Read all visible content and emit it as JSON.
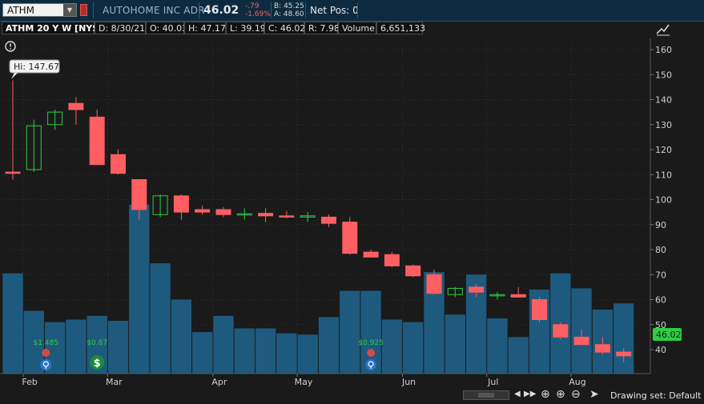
{
  "toolbar": {
    "symbol": "ATHM",
    "company_name": "AUTOHOME INC ADR",
    "last_price": "46.02",
    "net_change": "-.79",
    "pct_change": "-1.69%",
    "bid": "B: 45.25",
    "ask": "A: 48.60",
    "net_pos": "Net Pos: 0"
  },
  "info_bar": {
    "title": "ATHM 20 Y W [NYSE]",
    "date": "D: 8/30/21",
    "open": "O: 40.03",
    "high": "H: 47.17",
    "low": "L: 39.19",
    "close": "C: 46.02",
    "range": "R: 7.98",
    "volume_label": "Volume",
    "volume_value": "6,651,133"
  },
  "annotations": {
    "hi_label": "Hi: 147.67",
    "price_tag": "46.02",
    "dividends": [
      "$1.485",
      "$0.87",
      "$0.925"
    ]
  },
  "footer": {
    "drawing_set": "Drawing set: Default"
  },
  "chart_data": {
    "type": "candlestick",
    "y_axis_ticks": [
      40,
      50,
      60,
      70,
      80,
      90,
      100,
      110,
      120,
      130,
      140,
      150,
      160
    ],
    "ylim": [
      32,
      164
    ],
    "x_axis_labels": [
      {
        "label": "Feb",
        "week": 1
      },
      {
        "label": "Mar",
        "week": 5
      },
      {
        "label": "Apr",
        "week": 10
      },
      {
        "label": "May",
        "week": 14
      },
      {
        "label": "Jun",
        "week": 19
      },
      {
        "label": "Jul",
        "week": 23
      },
      {
        "label": "Aug",
        "week": 27
      }
    ],
    "grid": true,
    "candles": [
      {
        "week": 0,
        "open": 111,
        "high": 147.67,
        "low": 108,
        "close": 110.5
      },
      {
        "week": 1,
        "open": 112,
        "high": 132,
        "low": 111,
        "close": 129.5
      },
      {
        "week": 2,
        "open": 130,
        "high": 136,
        "low": 128,
        "close": 135
      },
      {
        "week": 3,
        "open": 138.5,
        "high": 141,
        "low": 130,
        "close": 136
      },
      {
        "week": 4,
        "open": 133,
        "high": 136,
        "low": 114,
        "close": 114
      },
      {
        "week": 5,
        "open": 118,
        "high": 120,
        "low": 110,
        "close": 110.5
      },
      {
        "week": 6,
        "open": 108,
        "high": 108,
        "low": 92,
        "close": 96
      },
      {
        "week": 7,
        "open": 94,
        "high": 102,
        "low": 93,
        "close": 101.5
      },
      {
        "week": 8,
        "open": 101.5,
        "high": 102,
        "low": 92,
        "close": 95
      },
      {
        "week": 9,
        "open": 96,
        "high": 97.5,
        "low": 94,
        "close": 95
      },
      {
        "week": 10,
        "open": 96,
        "high": 97,
        "low": 93,
        "close": 94
      },
      {
        "week": 11,
        "open": 94,
        "high": 96.5,
        "low": 92,
        "close": 94.3
      },
      {
        "week": 12,
        "open": 94.5,
        "high": 96.5,
        "low": 91,
        "close": 93.5
      },
      {
        "week": 13,
        "open": 93.5,
        "high": 95.5,
        "low": 92.5,
        "close": 93
      },
      {
        "week": 14,
        "open": 93,
        "high": 95,
        "low": 91,
        "close": 93.5
      },
      {
        "week": 15,
        "open": 93,
        "high": 94,
        "low": 89,
        "close": 90.5
      },
      {
        "week": 16,
        "open": 91,
        "high": 93,
        "low": 78,
        "close": 78.5
      },
      {
        "week": 17,
        "open": 79,
        "high": 80,
        "low": 77,
        "close": 77
      },
      {
        "week": 18,
        "open": 78,
        "high": 79,
        "low": 73,
        "close": 73.5
      },
      {
        "week": 19,
        "open": 73.5,
        "high": 74,
        "low": 69,
        "close": 69.5
      },
      {
        "week": 20,
        "open": 70,
        "high": 72,
        "low": 62,
        "close": 62.5
      },
      {
        "week": 21,
        "open": 62,
        "high": 65,
        "low": 61,
        "close": 64.5
      },
      {
        "week": 22,
        "open": 65,
        "high": 66,
        "low": 61,
        "close": 63
      },
      {
        "week": 23,
        "open": 61.5,
        "high": 63,
        "low": 60,
        "close": 62
      },
      {
        "week": 24,
        "open": 62,
        "high": 65,
        "low": 61,
        "close": 61
      },
      {
        "week": 25,
        "open": 60,
        "high": 61,
        "low": 51,
        "close": 52
      },
      {
        "week": 26,
        "open": 50,
        "high": 51,
        "low": 44,
        "close": 45
      },
      {
        "week": 27,
        "open": 45,
        "high": 48,
        "low": 42,
        "close": 42
      },
      {
        "week": 28,
        "open": 42,
        "high": 45,
        "low": 38,
        "close": 39
      },
      {
        "week": 29,
        "open": 39,
        "high": 40.5,
        "low": 35,
        "close": 37.5
      }
    ],
    "volume_bar_height_in_price_units": [
      70.5,
      55.5,
      51,
      52,
      53.5,
      51.5,
      98,
      74.5,
      60,
      47,
      53.5,
      48.5,
      48.5,
      46.5,
      46,
      53,
      63.5,
      63.5,
      52,
      51,
      71,
      54,
      70,
      52.5,
      45,
      64,
      70.5,
      64.5,
      56,
      58.5
    ],
    "dividend_markers": [
      {
        "week": 1,
        "label": "$1.485",
        "type": "earnings-bulb"
      },
      {
        "week": 4,
        "label": "$0.87",
        "type": "dividend-dollar"
      },
      {
        "week": 17,
        "label": "$0.925",
        "type": "earnings-bulb"
      }
    ],
    "colors": {
      "up": "#2fcc44",
      "down": "#ff5e62",
      "volume": "#1e5a7e",
      "background": "#1a1a1a",
      "grid": "#333333",
      "price_tag": "#2fcc44"
    }
  }
}
